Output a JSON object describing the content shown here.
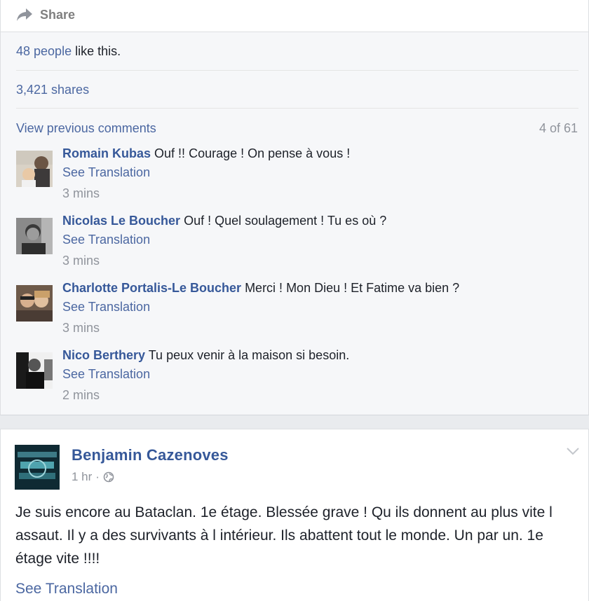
{
  "actions": {
    "share_label": "Share"
  },
  "engagement": {
    "likes_link": "48 people",
    "likes_suffix": " like this.",
    "shares": "3,421 shares"
  },
  "comments_section": {
    "view_previous": "View previous comments",
    "count": "4 of 61",
    "comments": [
      {
        "name": "Romain Kubas",
        "text": "Ouf !! Courage ! On pense à vous !",
        "translate": "See Translation",
        "time": "3 mins"
      },
      {
        "name": "Nicolas Le Boucher",
        "text": "Ouf ! Quel soulagement ! Tu es où ?",
        "translate": "See Translation",
        "time": "3 mins"
      },
      {
        "name": "Charlotte Portalis-Le Boucher",
        "text": "Merci ! Mon Dieu ! Et Fatime va bien ?",
        "translate": "See Translation",
        "time": "3 mins"
      },
      {
        "name": "Nico Berthery",
        "text": "Tu peux venir à la maison si besoin.",
        "translate": "See Translation",
        "time": "2 mins"
      }
    ]
  },
  "post": {
    "author": "Benjamin Cazenoves",
    "time": "1 hr",
    "dot": "·",
    "privacy_icon": "globe-icon",
    "text": "Je suis encore au Bataclan. 1e étage. Blessée grave ! Qu ils donnent au plus vite l assaut. Il y a des survivants à l intérieur. Ils abattent tout le monde. Un par un. 1e étage vite !!!!",
    "translate": "See Translation"
  },
  "colors": {
    "link": "#4b67a1",
    "name": "#365899",
    "muted": "#90949c",
    "background": "#e9ebee"
  }
}
